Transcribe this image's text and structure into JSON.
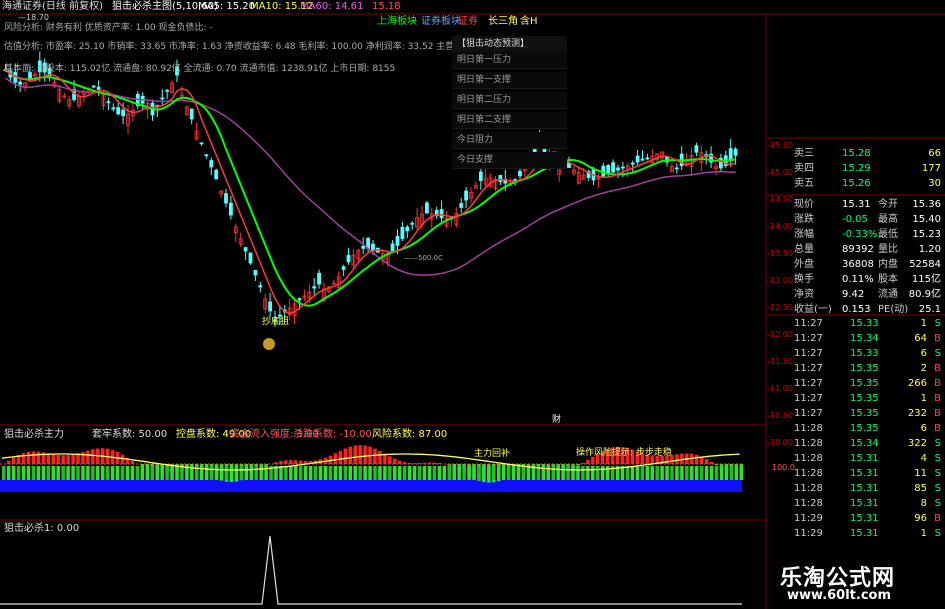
{
  "header": {
    "broker": "海通证券(日线 前复权)",
    "indicator": "狙击必杀主图(5,10,60)",
    "ma5_label": "MA5: 15.20",
    "ma10_label": "MA10: 15.12",
    "ma60_label": "MA60: 14.61",
    "price_tag": "15.18",
    "plate": "上海板块",
    "plate2": "证券板块",
    "tag_a": "证券",
    "tag_b": "长三角",
    "tag_c": "含H"
  },
  "info": {
    "line1": "风险分析: 财务有利   优质资产率: 1.00 现金负债比: -",
    "line2": "估值分析: 市盈率: 25.10 市销率: 33.65 市净率: 1.63 净资收益率: 6.48 毛利率: 100.00 净利润率: 33.52 主营利润率: 44.75",
    "line3": "基本面: 总股本: 115.02亿 流通盘: 80.92亿 全流通: 0.70 流通市值: 1238.91亿 上市日期: 8155",
    "small_label": "—18.70"
  },
  "menu": {
    "title": "【狙击动态预测】",
    "items": [
      "明日第一压力",
      "明日第一支撑",
      "明日第二压力",
      "明日第二支撑",
      "今日阻力",
      "今日支撑"
    ]
  },
  "chart_marks": {
    "annotation": "抄底狙",
    "low_label": "——500.0C",
    "fin_marker": "财"
  },
  "price_axis": [
    "15.50",
    "15.00",
    "14.50",
    "14.00",
    "13.50",
    "13.00",
    "12.50",
    "12.00",
    "11.50",
    "11.00",
    "10.50",
    "10.00"
  ],
  "sub1": {
    "title": "狙击必杀主力",
    "k1": "套牢系数: 50.00",
    "k2": "控盘系数: 49.00",
    "k3": "资金流入强度: 3.00",
    "k4": "杀跌系数: -10.00",
    "k5": "风险系数: 87.00",
    "k6": "主力回补",
    "k7": "操作风险提示: 步步走稳",
    "axis": "100.0"
  },
  "sub2": {
    "title": "狙击必杀1: 0.00"
  },
  "quote": {
    "asks": [
      {
        "label": "卖三",
        "price": "15.28",
        "vol": "66"
      },
      {
        "label": "卖四",
        "price": "15.29",
        "vol": "177"
      },
      {
        "label": "卖五",
        "price": "15.26",
        "vol": "30"
      }
    ],
    "stats": [
      {
        "l1": "现价",
        "v1": "15.31",
        "l2": "今开",
        "v2": "15.36"
      },
      {
        "l1": "涨跌",
        "v1": "-0.05",
        "l2": "最高",
        "v2": "15.40"
      },
      {
        "l1": "涨幅",
        "v1": "-0.33%",
        "l2": "最低",
        "v2": "15.23"
      },
      {
        "l1": "总量",
        "v1": "89392",
        "l2": "量比",
        "v2": "1.20"
      },
      {
        "l1": "外盘",
        "v1": "36808",
        "l2": "内盘",
        "v2": "52584"
      },
      {
        "l1": "换手",
        "v1": "0.11%",
        "l2": "股本",
        "v2": "115亿"
      },
      {
        "l1": "净资",
        "v1": "9.42",
        "l2": "流通",
        "v2": "80.9亿"
      },
      {
        "l1": "收益(一)",
        "v1": "0.153",
        "l2": "PE(动)",
        "v2": "25.1"
      }
    ],
    "ticks": [
      {
        "time": "11:27",
        "price": "15.33",
        "vol": "1",
        "dir": "S"
      },
      {
        "time": "11:27",
        "price": "15.34",
        "vol": "64",
        "dir": "B"
      },
      {
        "time": "11:27",
        "price": "15.33",
        "vol": "6",
        "dir": "S"
      },
      {
        "time": "11:27",
        "price": "15.35",
        "vol": "2",
        "dir": "B"
      },
      {
        "time": "11:27",
        "price": "15.35",
        "vol": "266",
        "dir": "B"
      },
      {
        "time": "11:27",
        "price": "15.35",
        "vol": "1",
        "dir": "B"
      },
      {
        "time": "11:27",
        "price": "15.35",
        "vol": "232",
        "dir": "B"
      },
      {
        "time": "11:28",
        "price": "15.35",
        "vol": "6",
        "dir": "B"
      },
      {
        "time": "11:28",
        "price": "15.34",
        "vol": "322",
        "dir": "S"
      },
      {
        "time": "11:28",
        "price": "15.31",
        "vol": "4",
        "dir": "S"
      },
      {
        "time": "11:28",
        "price": "15.31",
        "vol": "11",
        "dir": "S"
      },
      {
        "time": "11:28",
        "price": "15.31",
        "vol": "85",
        "dir": "S"
      },
      {
        "time": "11:28",
        "price": "15.31",
        "vol": "8",
        "dir": "S"
      },
      {
        "time": "11:29",
        "price": "15.31",
        "vol": "96",
        "dir": "B"
      },
      {
        "time": "11:29",
        "price": "15.31",
        "vol": "1",
        "dir": "S"
      }
    ]
  },
  "watermark": {
    "text": "乐淘公式网",
    "url": "www.60lt.com"
  },
  "colors": {
    "up": "#ff3232",
    "down": "#54ffff",
    "ma_green": "#00ff00",
    "ma_red": "#ff3a3a",
    "ma_purple": "#a0409c",
    "yellow": "#ffff33",
    "grid": "#7a0000"
  }
}
